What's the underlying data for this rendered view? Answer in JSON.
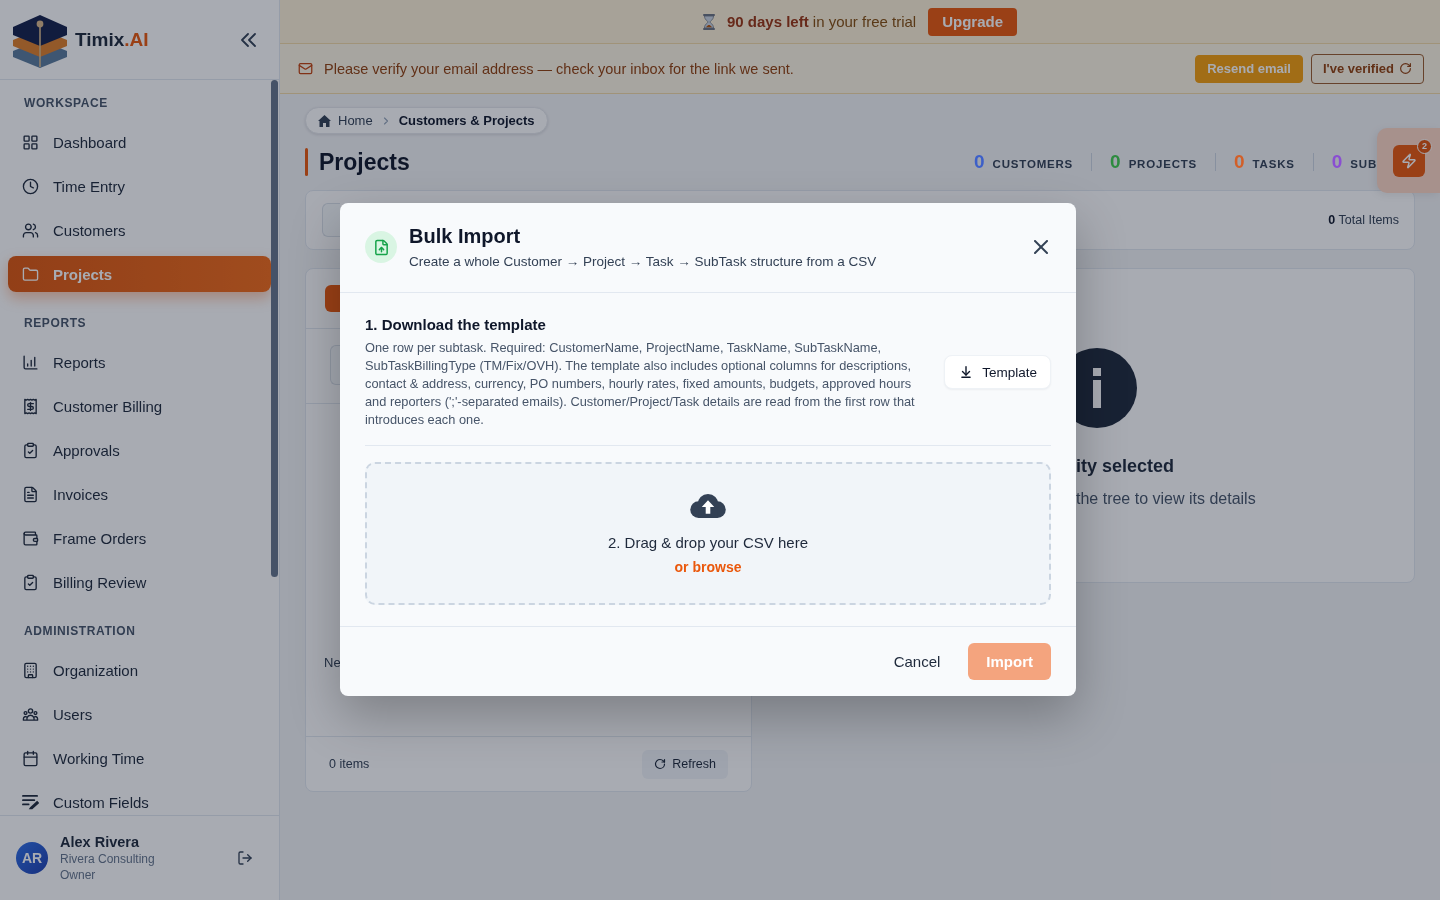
{
  "sidebar": {
    "brand": {
      "name": "Timix",
      "accent": ".AI"
    },
    "sections": [
      {
        "title": "WORKSPACE",
        "items": [
          {
            "label": "Dashboard",
            "selected": false
          },
          {
            "label": "Time Entry",
            "selected": false
          },
          {
            "label": "Customers",
            "selected": false
          },
          {
            "label": "Projects",
            "selected": true
          }
        ]
      },
      {
        "title": "REPORTS",
        "items": [
          {
            "label": "Reports",
            "selected": false
          },
          {
            "label": "Customer Billing",
            "selected": false
          },
          {
            "label": "Approvals",
            "selected": false
          },
          {
            "label": "Invoices",
            "selected": false
          },
          {
            "label": "Frame Orders",
            "selected": false
          },
          {
            "label": "Billing Review",
            "selected": false
          }
        ]
      },
      {
        "title": "ADMINISTRATION",
        "items": [
          {
            "label": "Organization",
            "selected": false
          },
          {
            "label": "Users",
            "selected": false
          },
          {
            "label": "Working Time",
            "selected": false
          },
          {
            "label": "Custom Fields",
            "selected": false
          }
        ]
      }
    ],
    "user": {
      "initials": "AR",
      "name": "Alex Rivera",
      "company": "Rivera Consulting",
      "role": "Owner"
    }
  },
  "trial_banner": {
    "text": "**90 days left** in your free trial",
    "button": "Upgrade"
  },
  "verify_banner": {
    "text": "Please verify your email address — check your inbox for the link we sent.",
    "buttons": [
      {
        "label": "Resend email",
        "kind": "solid"
      },
      {
        "label": "I've verified",
        "kind": "outline"
      }
    ]
  },
  "breadcrumb": [
    {
      "label": "Home",
      "selected": false
    },
    {
      "label": "Customers & Projects",
      "selected": true
    }
  ],
  "page_title": "Projects",
  "stats": [
    {
      "value": "0",
      "label": "CUSTOMERS",
      "color": "#3c5fc8"
    },
    {
      "value": "0",
      "label": "PROJECTS",
      "color": "#2e8b40"
    },
    {
      "value": "0",
      "label": "TASKS",
      "color": "#d25f28"
    },
    {
      "value": "0",
      "label": "SUB",
      "color": "#8a4ed2"
    }
  ],
  "quick_actions": {
    "badge": "2"
  },
  "toolbar": {
    "total": "**0** Total Items"
  },
  "tree_panel": {
    "texts": [
      "Ne"
    ],
    "footer": {
      "count": "0 items",
      "button": "Refresh"
    }
  },
  "details_panel": {
    "title": "ity selected",
    "hint": "the tree to view its details"
  },
  "modal": {
    "title": "Bulk Import",
    "subtitle": "Create a whole Customer → Project → Task → SubTask structure from a CSV",
    "step": {
      "heading": "1. Download the template",
      "description": "One row per subtask. Required: CustomerName, ProjectName, TaskName, SubTaskName, SubTaskBillingType (TM/Fix/OVH). The template also includes optional columns for descriptions, contact & address, currency, PO numbers, hourly rates, fixed amounts, budgets, approved hours and reporters (';'-separated emails). Customer/Project/Task details are read from the first row that introduces each one.",
      "button": "Template"
    },
    "dropzone": {
      "text": "2. Drag & drop your CSV here",
      "link": "or browse"
    },
    "buttons": [
      {
        "label": "Cancel",
        "kind": "text",
        "disabled": false
      },
      {
        "label": "Import",
        "kind": "primary",
        "disabled": true
      }
    ]
  }
}
